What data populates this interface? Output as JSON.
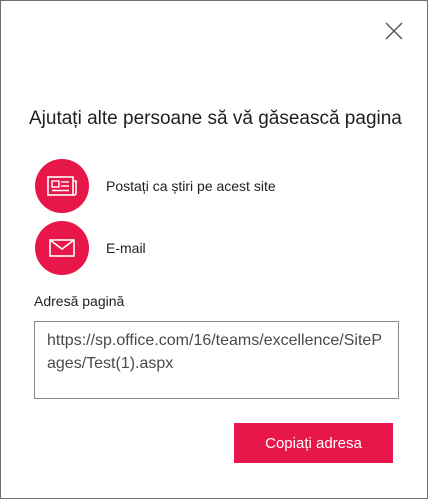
{
  "dialog": {
    "title": "Ajutați alte persoane să vă găsească pagina",
    "close_icon": "close-icon",
    "accent_color": "#e8174a"
  },
  "share_options": [
    {
      "label": "Postați ca știri pe acest site",
      "icon": "news-icon"
    },
    {
      "label": "E-mail",
      "icon": "mail-icon"
    }
  ],
  "page_address": {
    "label": "Adresă pagină",
    "value": "https://sp.office.com/16/teams/excellence/SitePages/Test(1).aspx"
  },
  "copy_button": {
    "label": "Copiați adresa"
  }
}
